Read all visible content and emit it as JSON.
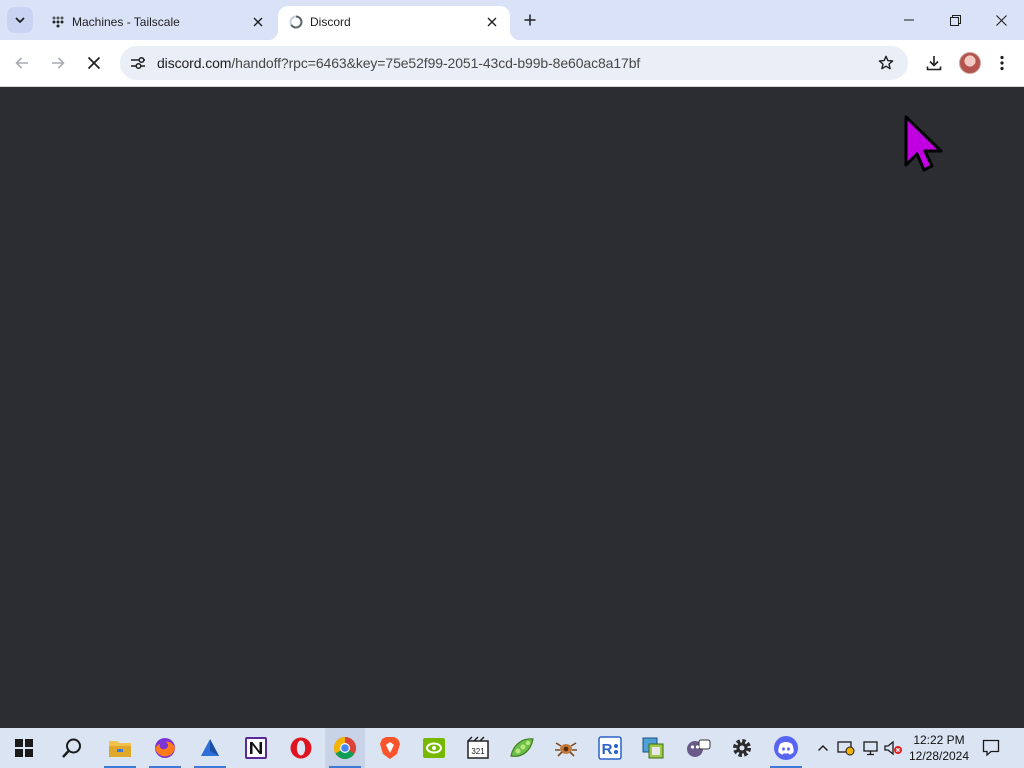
{
  "browser": {
    "tabs": [
      {
        "title": "Machines - Tailscale",
        "icon": "tailscale-icon",
        "active": false
      },
      {
        "title": "Discord",
        "icon": "loading-spinner-icon",
        "active": true
      }
    ],
    "address": {
      "domain": "discord.com",
      "path": "/handoff?rpc=6463&key=75e52f99-2051-43cd-b99b-8e60ac8a17bf"
    }
  },
  "page": {
    "background_color": "#2b2d31"
  },
  "taskbar": {
    "apps": [
      "start-icon",
      "search-icon",
      "file-explorer-icon",
      "firefox-icon",
      "browser-app-icon",
      "notion-icon",
      "opera-icon",
      "chrome-icon",
      "brave-icon",
      "nvidia-icon",
      "media-player-icon",
      "pea-app-icon",
      "bug-app-icon",
      "remote-desktop-icon",
      "virtual-machine-icon",
      "game-app-icon",
      "settings-icon",
      "discord-icon"
    ],
    "clock": {
      "time": "12:22 PM",
      "date": "12/28/2024"
    }
  },
  "colors": {
    "tabstrip": "#dae2f8",
    "omnibox": "#e9eef7",
    "taskbar": "#dbe4f3",
    "cursor": "#c000e0"
  }
}
